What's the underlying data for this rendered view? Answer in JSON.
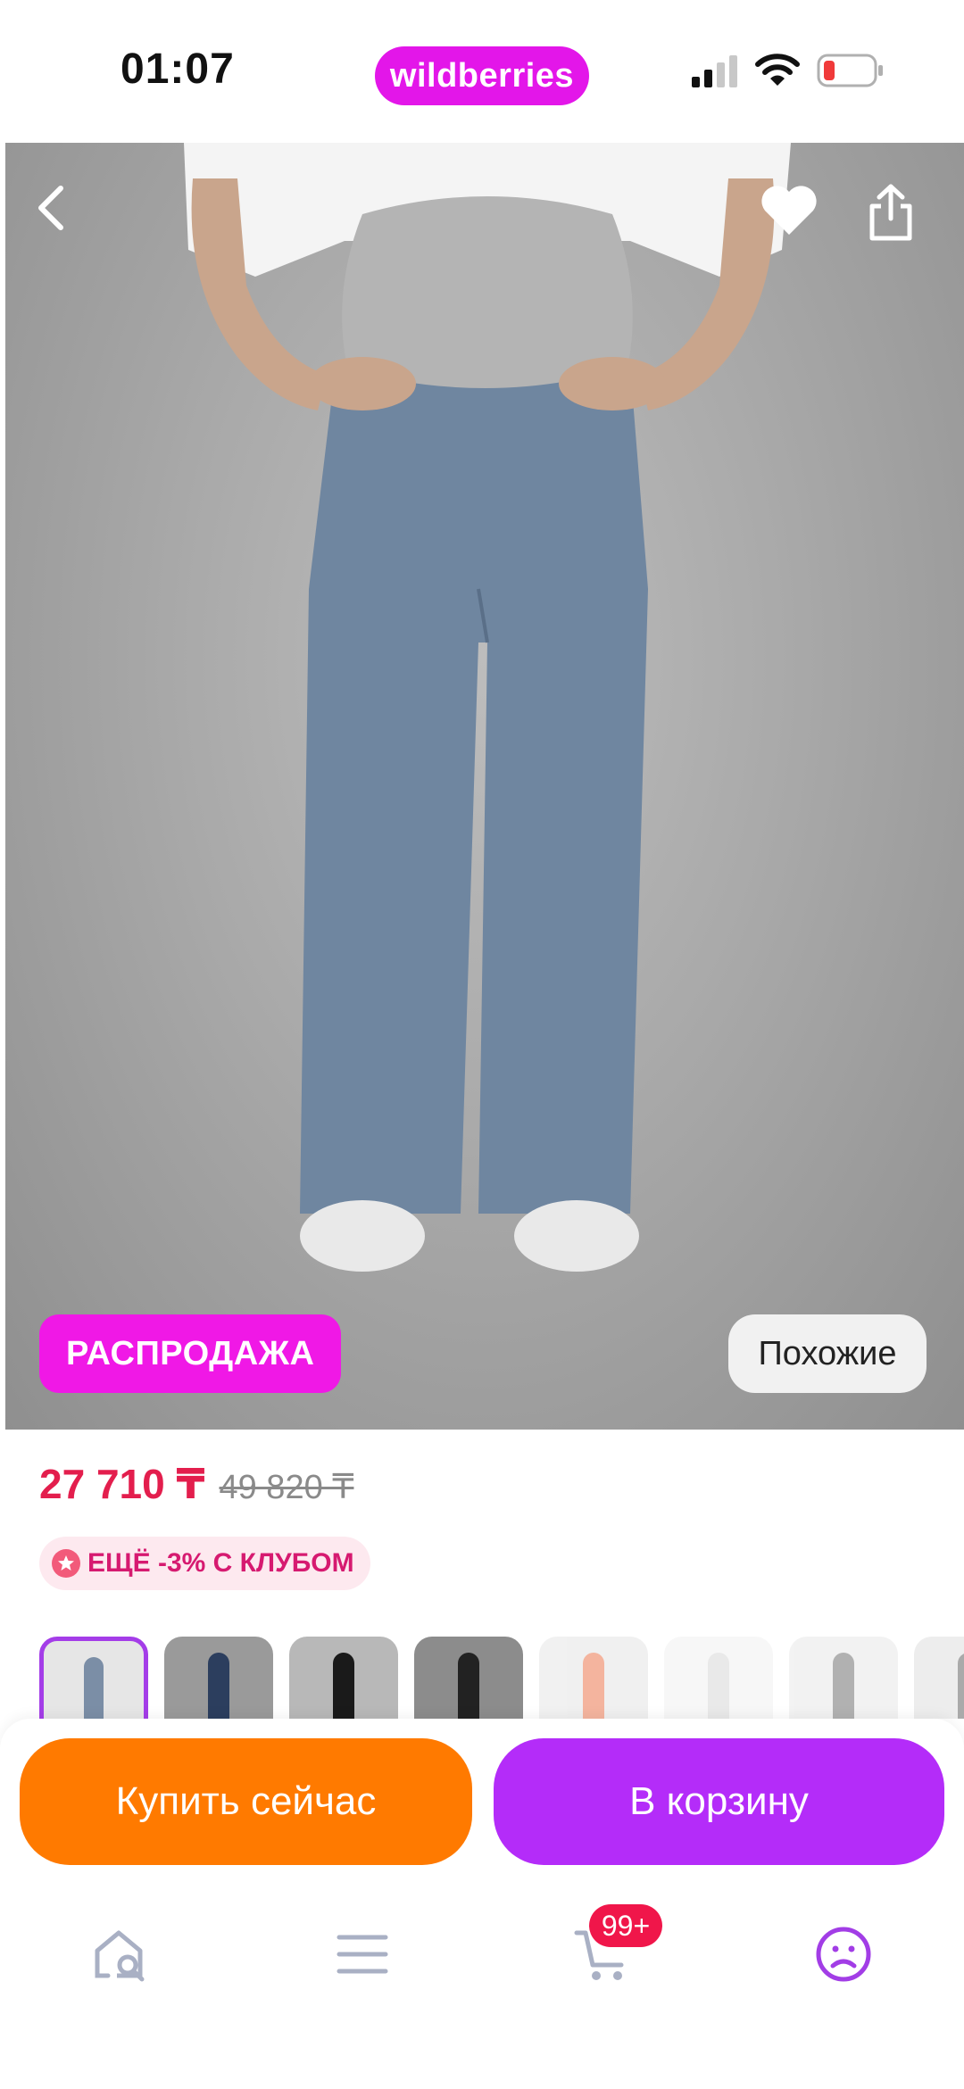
{
  "status_bar": {
    "time": "01:07",
    "brand": "wildberries",
    "icons": [
      "cellular-signal-icon",
      "wifi-icon",
      "battery-low-icon"
    ]
  },
  "hero": {
    "icons": [
      "back-icon",
      "heart-icon",
      "share-icon"
    ],
    "sale_label": "РАСПРОДАЖА",
    "similar_label": "Похожие"
  },
  "price": {
    "current": "27 710 ₸",
    "old": "49 820 ₸",
    "club_label": "ЕЩЁ -3% С КЛУБОМ"
  },
  "thumbnails": {
    "count_visible": 8,
    "active_index": 0
  },
  "actions": {
    "buy_now": "Купить сейчас",
    "add_to_cart": "В корзину"
  },
  "tabbar": {
    "items": [
      "home-search-icon",
      "menu-icon",
      "cart-icon",
      "profile-icon"
    ],
    "cart_badge": "99+",
    "active": "profile"
  },
  "colors": {
    "brand": "#e316e9",
    "sale": "#f018e6",
    "price": "#e31e4d",
    "buy": "#ff7a00",
    "cart": "#b42cf9",
    "badge": "#f0164a"
  }
}
